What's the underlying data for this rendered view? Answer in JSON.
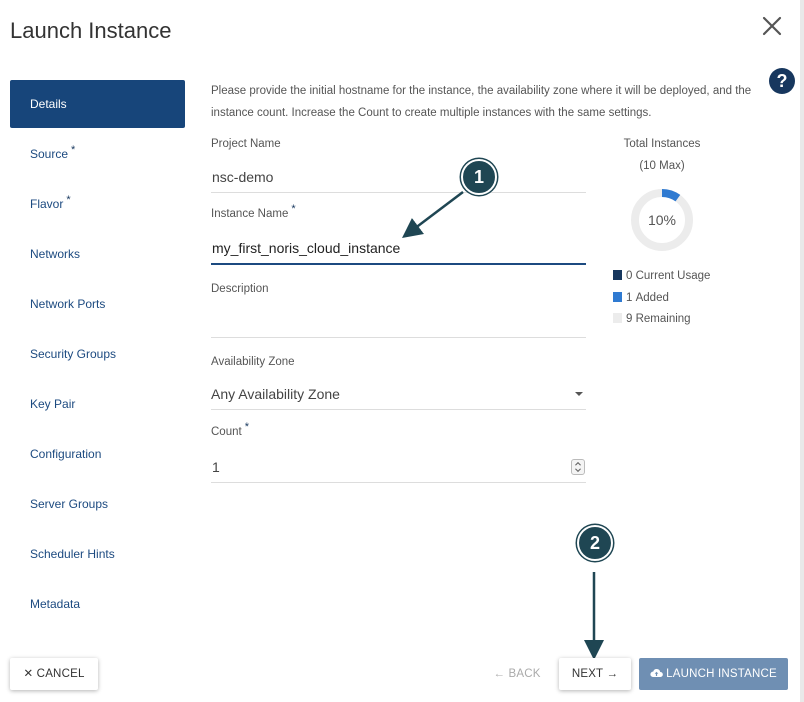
{
  "dialog": {
    "title": "Launch Instance",
    "close_glyph": "✕",
    "help_glyph": "?"
  },
  "sidebar": {
    "items": [
      {
        "label": "Details",
        "required": false
      },
      {
        "label": "Source",
        "required": true
      },
      {
        "label": "Flavor",
        "required": true
      },
      {
        "label": "Networks",
        "required": false
      },
      {
        "label": "Network Ports",
        "required": false
      },
      {
        "label": "Security Groups",
        "required": false
      },
      {
        "label": "Key Pair",
        "required": false
      },
      {
        "label": "Configuration",
        "required": false
      },
      {
        "label": "Server Groups",
        "required": false
      },
      {
        "label": "Scheduler Hints",
        "required": false
      },
      {
        "label": "Metadata",
        "required": false
      }
    ],
    "required_marker": "*"
  },
  "details": {
    "intro": "Please provide the initial hostname for the instance, the availability zone where it will be deployed, and the instance count. Increase the Count to create multiple instances with the same settings.",
    "project_name_label": "Project Name",
    "project_name_value": "nsc-demo",
    "instance_name_label": "Instance Name",
    "instance_name_value": "my_first_noris_cloud_instance",
    "description_label": "Description",
    "description_value": "",
    "availability_zone_label": "Availability Zone",
    "availability_zone_value": "Any Availability Zone",
    "count_label": "Count",
    "count_value": "1"
  },
  "total_instances": {
    "title": "Total Instances",
    "max": "(10 Max)",
    "percent_label": "10%",
    "fraction_used": 0.1,
    "legend": [
      {
        "count": "0",
        "label": "Current Usage",
        "color": "#17375e"
      },
      {
        "count": "1",
        "label": "Added",
        "color": "#2f7ad1"
      },
      {
        "count": "9",
        "label": "Remaining",
        "color": "#ececec"
      }
    ]
  },
  "annotations": {
    "marker1": "1",
    "marker2": "2"
  },
  "footer": {
    "cancel_label": "✕ CANCEL",
    "back_label": "← BACK",
    "next_label": "NEXT →",
    "launch_label": "LAUNCH INSTANCE"
  },
  "colors": {
    "primary": "#17457a",
    "accent": "#2f7ad1",
    "marker": "#1f4653",
    "launch_button": "#6f8fb3"
  }
}
